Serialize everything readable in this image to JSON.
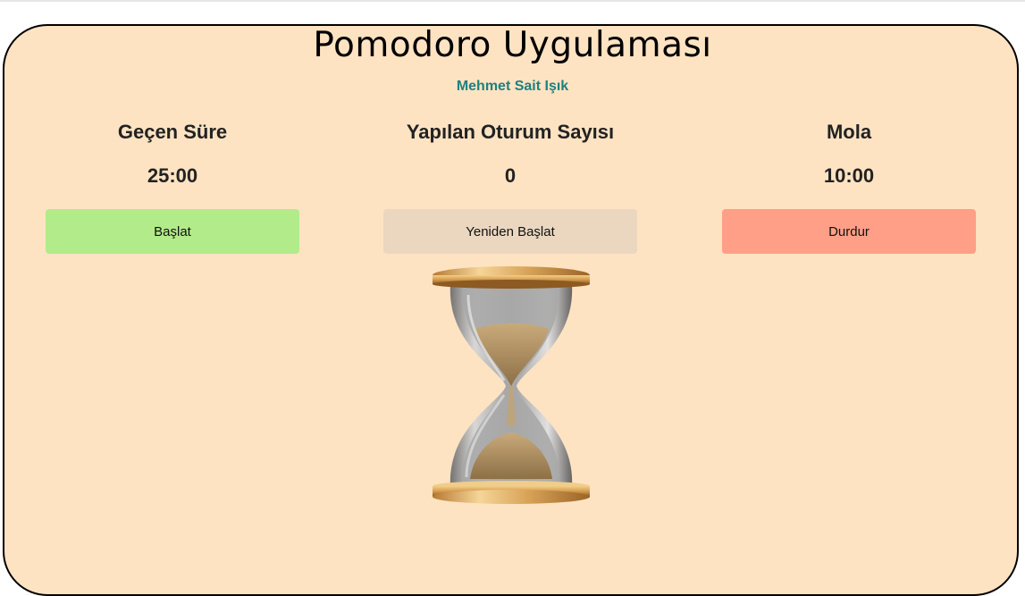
{
  "app": {
    "title": "Pomodoro Uygulaması",
    "author": "Mehmet Sait Işık"
  },
  "stats": [
    {
      "label": "Geçen Süre",
      "value": "25:00"
    },
    {
      "label": "Yapılan Oturum Sayısı",
      "value": "0"
    },
    {
      "label": "Mola",
      "value": "10:00"
    }
  ],
  "buttons": {
    "start": {
      "label": "Başlat",
      "color": "#b2eb8a"
    },
    "restart": {
      "label": "Yeniden Başlat",
      "color": "#ebd7c0"
    },
    "stop": {
      "label": "Durdur",
      "color": "#ff9f87"
    }
  },
  "image": {
    "icon": "hourglass-icon"
  },
  "colors": {
    "background": "#fee3c2",
    "author_text": "#1f8080"
  }
}
